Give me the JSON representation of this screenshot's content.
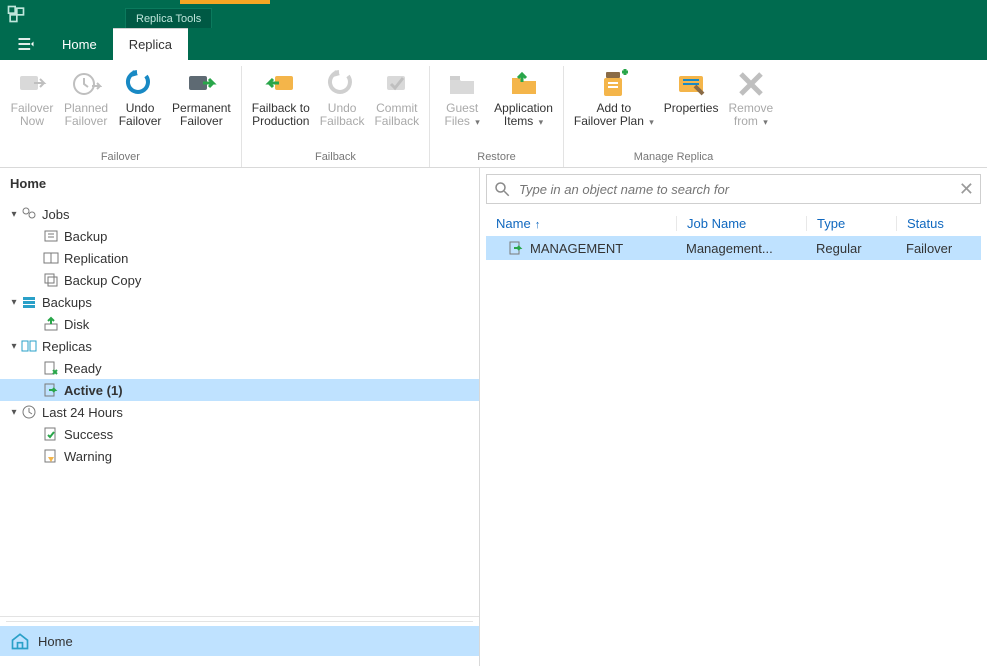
{
  "titlebar": {
    "context_tab": "Replica Tools"
  },
  "tabs": {
    "home": "Home",
    "replica": "Replica"
  },
  "ribbon": {
    "groups": [
      {
        "title": "Failover",
        "buttons": [
          {
            "label": "Failover\nNow",
            "has_caret": false,
            "enabled": false
          },
          {
            "label": "Planned\nFailover",
            "has_caret": false,
            "enabled": false
          },
          {
            "label": "Undo\nFailover",
            "has_caret": false,
            "enabled": true
          },
          {
            "label": "Permanent\nFailover",
            "has_caret": false,
            "enabled": true
          }
        ]
      },
      {
        "title": "Failback",
        "buttons": [
          {
            "label": "Failback to\nProduction",
            "has_caret": false,
            "enabled": true
          },
          {
            "label": "Undo\nFailback",
            "has_caret": false,
            "enabled": false
          },
          {
            "label": "Commit\nFailback",
            "has_caret": false,
            "enabled": false
          }
        ]
      },
      {
        "title": "Restore",
        "buttons": [
          {
            "label": "Guest\nFiles",
            "has_caret": true,
            "enabled": false
          },
          {
            "label": "Application\nItems",
            "has_caret": true,
            "enabled": true
          }
        ]
      },
      {
        "title": "Manage Replica",
        "buttons": [
          {
            "label": "Add to\nFailover Plan",
            "has_caret": true,
            "enabled": true
          },
          {
            "label": "Properties",
            "has_caret": false,
            "enabled": true
          },
          {
            "label": "Remove\nfrom",
            "has_caret": true,
            "enabled": false
          }
        ]
      }
    ]
  },
  "nav": {
    "title": "Home",
    "tree": [
      {
        "depth": 0,
        "toggle": "▾",
        "label": "Jobs"
      },
      {
        "depth": 1,
        "toggle": "",
        "label": "Backup"
      },
      {
        "depth": 1,
        "toggle": "",
        "label": "Replication"
      },
      {
        "depth": 1,
        "toggle": "",
        "label": "Backup Copy"
      },
      {
        "depth": 0,
        "toggle": "▾",
        "label": "Backups"
      },
      {
        "depth": 1,
        "toggle": "",
        "label": "Disk"
      },
      {
        "depth": 0,
        "toggle": "▾",
        "label": "Replicas"
      },
      {
        "depth": 1,
        "toggle": "",
        "label": "Ready"
      },
      {
        "depth": 1,
        "toggle": "",
        "label": "Active (1)",
        "bold": true,
        "selected": true
      },
      {
        "depth": 0,
        "toggle": "▾",
        "label": "Last 24 Hours"
      },
      {
        "depth": 1,
        "toggle": "",
        "label": "Success"
      },
      {
        "depth": 1,
        "toggle": "",
        "label": "Warning"
      }
    ],
    "bottom": {
      "home": "Home"
    }
  },
  "search": {
    "placeholder": "Type in an object name to search for"
  },
  "grid": {
    "columns": {
      "name": "Name",
      "job": "Job Name",
      "type": "Type",
      "status": "Status"
    },
    "rows": [
      {
        "name": "MANAGEMENT",
        "job": "Management...",
        "type": "Regular",
        "status": "Failover"
      }
    ]
  }
}
